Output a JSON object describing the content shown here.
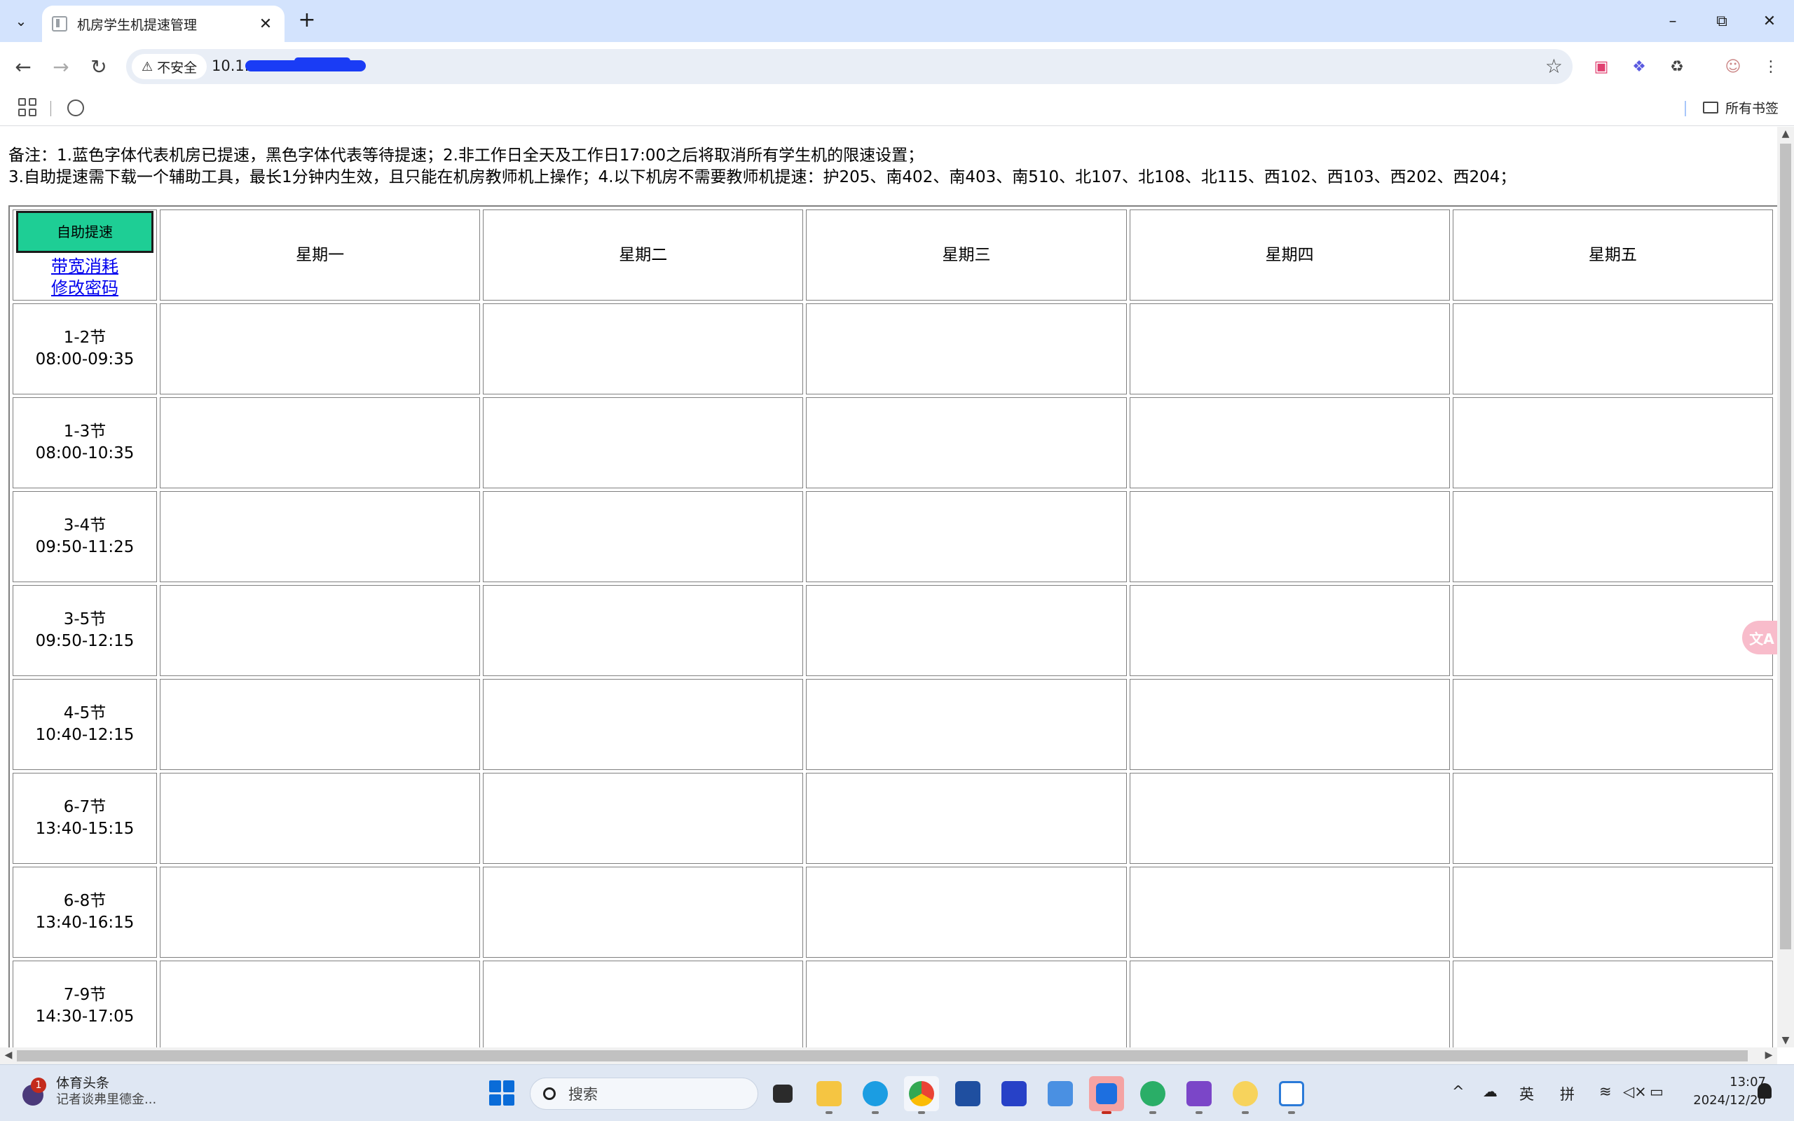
{
  "browser": {
    "tab_title": "机房学生机提速管理",
    "security_label": "不安全",
    "url_visible": "10.1.",
    "bookmarks_all": "所有书签"
  },
  "page": {
    "note_line1": "备注：1.蓝色字体代表机房已提速，黑色字体代表等待提速；2.非工作日全天及工作日17:00之后将取消所有学生机的限速设置；",
    "note_line2": "3.自助提速需下载一个辅助工具，最长1分钟内生效，且只能在机房教师机上操作；4.以下机房不需要教师机提速：护205、南402、南403、南510、北107、北108、北115、西102、西103、西202、西204；",
    "self_speedup_button": "自助提速",
    "bandwidth_link": "带宽消耗",
    "change_password_link": "修改密码",
    "days": [
      "星期一",
      "星期二",
      "星期三",
      "星期四",
      "星期五"
    ],
    "periods": [
      {
        "label": "1-2节",
        "time": "08:00-09:35"
      },
      {
        "label": "1-3节",
        "time": "08:00-10:35"
      },
      {
        "label": "3-4节",
        "time": "09:50-11:25"
      },
      {
        "label": "3-5节",
        "time": "09:50-12:15"
      },
      {
        "label": "4-5节",
        "time": "10:40-12:15"
      },
      {
        "label": "6-7节",
        "time": "13:40-15:15"
      },
      {
        "label": "6-8节",
        "time": "13:40-16:15"
      },
      {
        "label": "7-9节",
        "time": "14:30-17:05"
      }
    ]
  },
  "taskbar": {
    "news_title": "体育头条",
    "news_sub": "记者谈弗里德金...",
    "news_badge": "1",
    "search_placeholder": "搜索",
    "ime_lang": "英",
    "ime_mode": "拼",
    "time": "13:07",
    "date": "2024/12/20"
  },
  "colors": {
    "self_button_bg": "#1ece95",
    "link": "#0000ee",
    "tabbar": "#d3e3fd"
  }
}
